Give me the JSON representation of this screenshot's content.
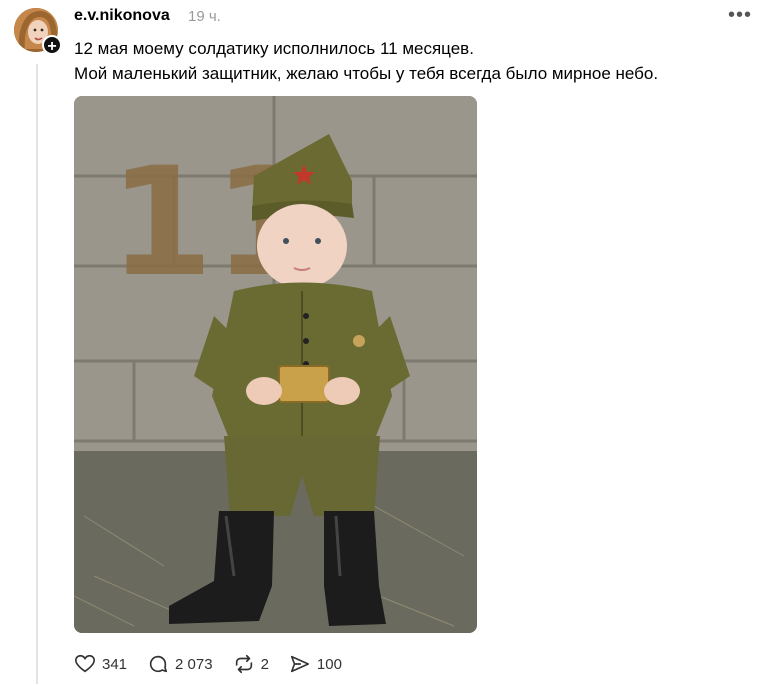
{
  "post": {
    "username": "e.v.nikonova",
    "time": "19 ч.",
    "text_line1": "12 мая моему солдатику исполнилось 11 месяцев.",
    "text_line2": "Мой маленький защитник, желаю чтобы у тебя всегда было мирное небо.",
    "photo_number": "11"
  },
  "actions": {
    "likes": "341",
    "replies": "2 073",
    "reposts": "2",
    "shares": "100"
  },
  "icons": {
    "more": "more-icon",
    "like": "heart-icon",
    "reply": "comment-icon",
    "repost": "repost-icon",
    "share": "send-icon",
    "follow": "plus-icon"
  }
}
